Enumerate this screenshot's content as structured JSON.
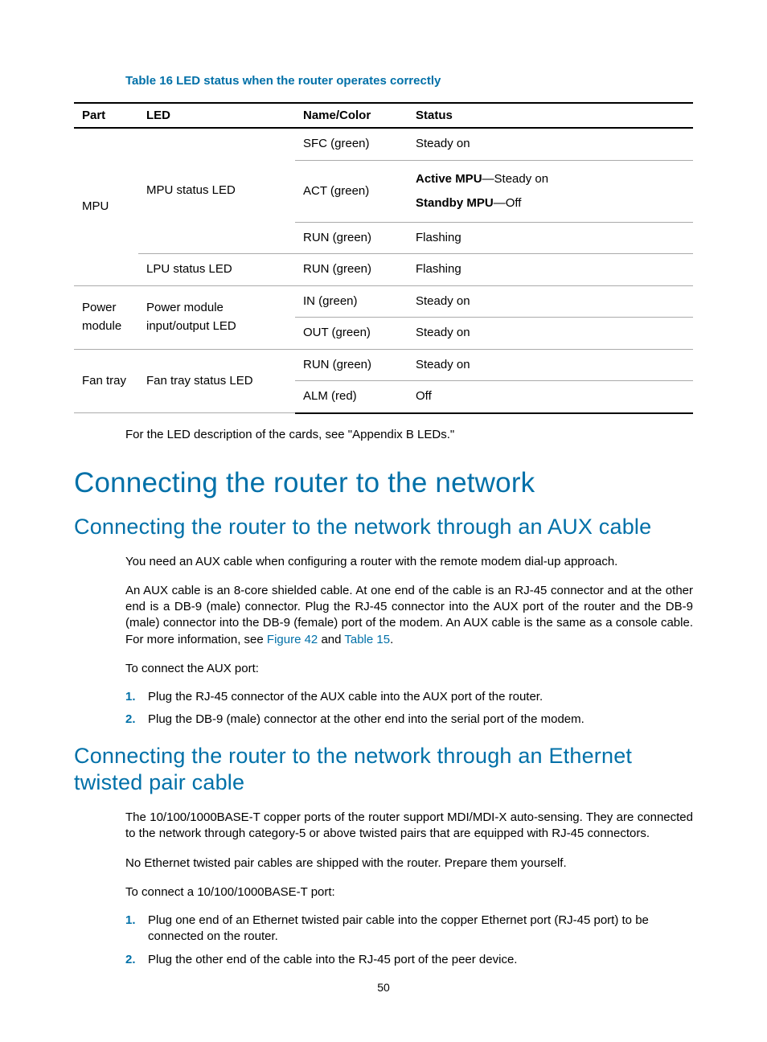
{
  "table": {
    "caption": "Table 16 LED status when the router operates correctly",
    "headers": {
      "part": "Part",
      "led": "LED",
      "name": "Name/Color",
      "status": "Status"
    },
    "mpu": {
      "part": "MPU",
      "status_led": "MPU status LED",
      "sfc": {
        "name": "SFC (green)",
        "status": "Steady on"
      },
      "act": {
        "name": "ACT (green)",
        "active_label": "Active MPU",
        "active_val": "—Steady on",
        "standby_label": "Standby MPU",
        "standby_val": "—Off"
      },
      "run": {
        "name": "RUN (green)",
        "status": "Flashing"
      }
    },
    "lpu": {
      "led": "LPU status LED",
      "name": "RUN (green)",
      "status": "Flashing"
    },
    "power": {
      "part": "Power module",
      "led": "Power module input/output LED",
      "in": {
        "name": "IN (green)",
        "status": "Steady on"
      },
      "out": {
        "name": "OUT (green)",
        "status": "Steady on"
      }
    },
    "fan": {
      "part": "Fan tray",
      "led": "Fan tray status LED",
      "run": {
        "name": "RUN (green)",
        "status": "Steady on"
      },
      "alm": {
        "name": "ALM (red)",
        "status": "Off"
      }
    }
  },
  "after_table": {
    "prefix": "For the LED description of the cards, see \"",
    "appendix": "Appendix B LEDs",
    "suffix": ".\""
  },
  "h1": "Connecting the router to the network",
  "aux": {
    "heading": "Connecting the router to the network through an AUX cable",
    "p1": "You need an AUX cable when configuring a router with the remote modem dial-up approach.",
    "p2a": "An AUX cable is an 8-core shielded cable. At one end of the cable is an RJ-45 connector and at the other end is a DB-9 (male) connector. Plug the RJ-45 connector into the AUX port of the router and the DB-9 (male) connector into the DB-9 (female) port of the modem. An AUX cable is the same as a console cable. For more information, see ",
    "link1": "Figure 42",
    "p2b": " and ",
    "link2": "Table 15",
    "p2c": ".",
    "p3": "To connect the AUX port:",
    "step1": "Plug the RJ-45 connector of the AUX cable into the AUX port of the router.",
    "step2": "Plug the DB-9 (male) connector at the other end into the serial port of the modem."
  },
  "eth": {
    "heading": "Connecting the router to the network through an Ethernet twisted pair cable",
    "p1": "The 10/100/1000BASE-T copper ports of the router support MDI/MDI-X auto-sensing. They are connected to the network through category-5 or above twisted pairs that are equipped with RJ-45 connectors.",
    "p2": "No Ethernet twisted pair cables are shipped with the router. Prepare them yourself.",
    "p3": "To connect a 10/100/1000BASE-T port:",
    "step1": "Plug one end of an Ethernet twisted pair cable into the copper Ethernet port (RJ-45 port) to be connected on the router.",
    "step2": "Plug the other end of the cable into the RJ-45 port of the peer device."
  },
  "page_number": "50"
}
